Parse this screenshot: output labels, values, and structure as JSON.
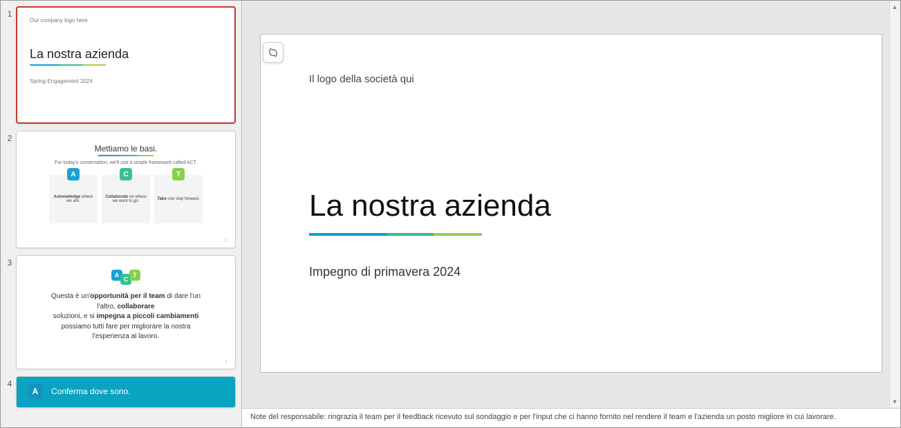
{
  "thumbnails": {
    "slide1": {
      "num": "1",
      "logo": "Our company logo here",
      "title": "La nostra azienda",
      "subtitle": "Spring Engagement 2024"
    },
    "slide2": {
      "num": "2",
      "heading": "Mettiamo le basi.",
      "sub": "For today's conversation, we'll use a simple framework called ACT.",
      "cardA_badge": "A",
      "cardA_strong": "Acknowledge",
      "cardA_rest": " where we are.",
      "cardC_badge": "C",
      "cardC_strong": "Collaborate",
      "cardC_rest": " on where we want to go.",
      "cardT_badge": "T",
      "cardT_strong": "Take",
      "cardT_rest": " one step forward."
    },
    "slide3": {
      "num": "3",
      "badgeA": "A",
      "badgeC": "C",
      "badgeT": "T",
      "line1a": "Questa è un'",
      "line1b": "opportunità per il team",
      "line1c": " di dare l'un l'altro, ",
      "line1d": "collaborare",
      "line2a": "soluzioni, e si ",
      "line2b": "impegna a piccoli cambiamenti",
      "line3": "possiamo tutti fare per migliorare la nostra",
      "line4": "l'esperienza al lavoro."
    },
    "slide4": {
      "num": "4",
      "badge": "A",
      "text": "Conferma dove sono."
    }
  },
  "main_slide": {
    "logo": "Il logo della società qui",
    "title": "La nostra azienda",
    "subtitle": "Impegno di primavera 2024"
  },
  "notes": "Note del responsabile: ringrazia il team per il feedback ricevuto sul sondaggio e per l'input che ci hanno fornito nel rendere il team e l'azienda un posto migliore in cui lavorare.",
  "icons": {
    "copilot": "copilot"
  }
}
